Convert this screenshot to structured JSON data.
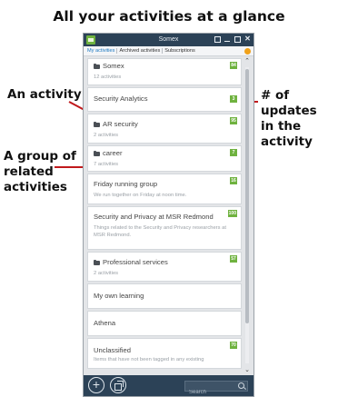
{
  "headline": "All your activities at a glance",
  "callouts": {
    "activity": "An activity",
    "updates_line1": "# of updates",
    "updates_line2": "in the activity",
    "group_line1": "A group of",
    "group_line2": "related",
    "group_line3": "activities"
  },
  "window": {
    "title": "Somex",
    "tabs": [
      "My activities",
      "Archived activities",
      "Subscriptions"
    ]
  },
  "cards": [
    {
      "title": "Somex",
      "subtitle": "12 activities",
      "badge": "84",
      "group": true
    },
    {
      "title": "Security Analytics",
      "subtitle": "",
      "badge": "3",
      "group": false
    },
    {
      "title": "AR security",
      "subtitle": "2 activities",
      "badge": "95",
      "group": true
    },
    {
      "title": "career",
      "subtitle": "7 activities",
      "badge": "7",
      "group": true
    },
    {
      "title": "Friday running group",
      "subtitle": "We run together on Friday at noon time.",
      "badge": "16",
      "group": false
    },
    {
      "title": "Security and Privacy at MSR Redmond",
      "subtitle": "Things related to the Security and Privacy researchers at MSR Redmond.",
      "badge": "100",
      "group": false
    },
    {
      "title": "Professional services",
      "subtitle": "2 activities",
      "badge": "57",
      "group": true
    },
    {
      "title": "My own learning",
      "subtitle": "",
      "badge": "",
      "group": false
    },
    {
      "title": "Athena",
      "subtitle": "",
      "badge": "",
      "group": false
    },
    {
      "title": "Unclassified",
      "subtitle": "Items that have not been tagged in any existing",
      "badge": "70",
      "group": false
    }
  ],
  "search": {
    "placeholder": "Search"
  },
  "colors": {
    "accent": "#6fb23f",
    "titlebar": "#2c4257",
    "callout_line": "#c0191c",
    "active_tab": "#1e7ac2"
  },
  "icons": [
    "app-logo-icon",
    "folder-icon",
    "add-icon",
    "add-group-icon",
    "search-icon",
    "chevron-up-icon",
    "chevron-down-icon"
  ]
}
